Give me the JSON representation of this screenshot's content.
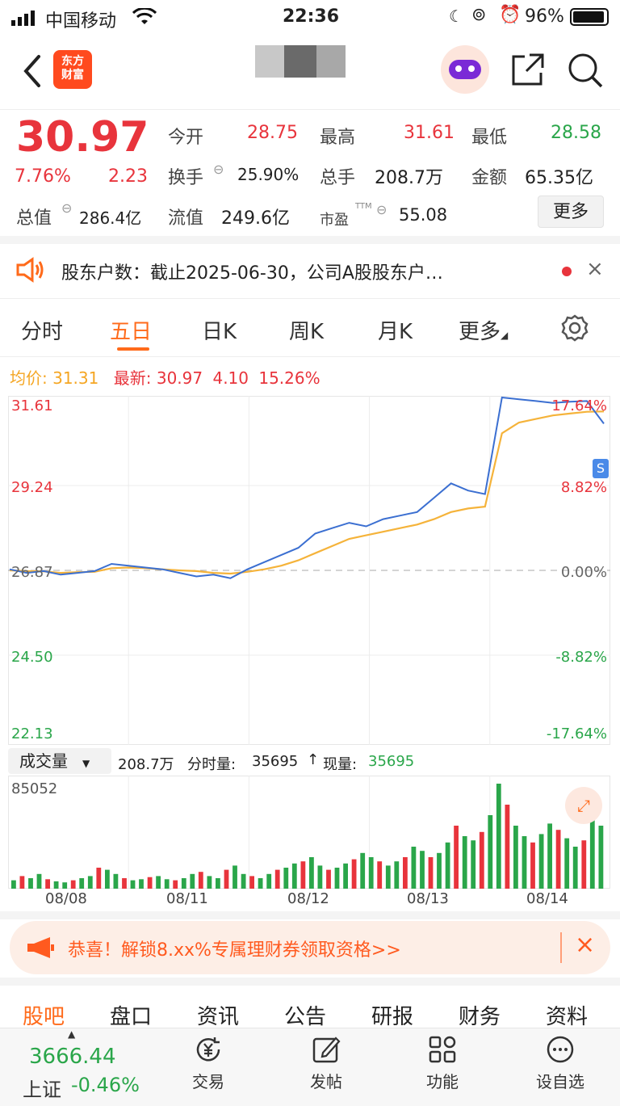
{
  "status_bar": {
    "carrier": "中国移动",
    "time": "22:36",
    "battery": "96%"
  },
  "nav": {
    "logo_text_1": "东方",
    "logo_text_2": "财富"
  },
  "quote": {
    "price": "30.97",
    "change_pct": "7.76%",
    "change": "2.23",
    "open_label": "今开",
    "open": "28.75",
    "high_label": "最高",
    "high": "31.61",
    "low_label": "最低",
    "low": "28.58",
    "turnover_label": "换手",
    "turnover": "25.90%",
    "volume_label": "总手",
    "volume": "208.7万",
    "amount_label": "金额",
    "amount": "65.35亿",
    "mktcap_label": "总值",
    "mktcap": "286.4亿",
    "float_label": "流值",
    "float": "249.6亿",
    "pe_label": "市盈",
    "pe_sup": "TTM",
    "pe": "55.08",
    "more_label": "更多"
  },
  "notice": {
    "text": "股东户数：截止2025-06-30，公司A股股东户…"
  },
  "tabs": [
    {
      "label": "分时"
    },
    {
      "label": "五日"
    },
    {
      "label": "日K"
    },
    {
      "label": "周K"
    },
    {
      "label": "月K"
    },
    {
      "label": "更多"
    }
  ],
  "legend": {
    "avg_label": "均价:",
    "avg": "31.31",
    "latest_label": "最新:",
    "latest": "30.97",
    "chg": "4.10",
    "chg_pct": "15.26%"
  },
  "chart_data": {
    "type": "line",
    "y_left_ticks": [
      "31.61",
      "29.24",
      "26.87",
      "24.50",
      "22.13"
    ],
    "y_right_ticks": [
      "17.64%",
      "8.82%",
      "0.00%",
      "-8.82%",
      "-17.64%"
    ],
    "ylim": [
      22.13,
      31.61
    ],
    "x_days": [
      "08/08",
      "08/11",
      "08/12",
      "08/13",
      "08/14"
    ],
    "series": [
      {
        "values": [
          26.9,
          26.8,
          26.85,
          26.75,
          26.8,
          26.85,
          27.05,
          27.0,
          26.95,
          26.9,
          26.8,
          26.7,
          26.75,
          26.65,
          26.9,
          27.1,
          27.3,
          27.5,
          27.9,
          28.05,
          28.2,
          28.1,
          28.3,
          28.4,
          28.5,
          28.9,
          29.3,
          29.1,
          29.0,
          31.7,
          31.65,
          31.6,
          31.55,
          31.58,
          31.6,
          30.97
        ]
      },
      {
        "values": [
          26.87,
          26.85,
          26.84,
          26.8,
          26.82,
          26.83,
          26.93,
          26.95,
          26.93,
          26.9,
          26.87,
          26.85,
          26.8,
          26.78,
          26.83,
          26.9,
          27.0,
          27.15,
          27.35,
          27.55,
          27.75,
          27.85,
          27.95,
          28.05,
          28.15,
          28.3,
          28.5,
          28.6,
          28.65,
          30.7,
          31.0,
          31.1,
          31.2,
          31.25,
          31.3,
          31.31
        ]
      }
    ]
  },
  "volume": {
    "selector": "成交量",
    "total": "208.7万",
    "tick_label": "分时量:",
    "tick_vol": "35695",
    "now_label": "现量:",
    "now_vol": "35695",
    "max": "85052",
    "bars": [
      8,
      12,
      10,
      14,
      9,
      7,
      6,
      8,
      10,
      12,
      20,
      18,
      14,
      10,
      8,
      9,
      11,
      12,
      9,
      8,
      10,
      14,
      16,
      12,
      10,
      18,
      22,
      14,
      12,
      10,
      14,
      18,
      20,
      24,
      26,
      30,
      22,
      18,
      20,
      24,
      28,
      34,
      30,
      26,
      22,
      26,
      30,
      40,
      36,
      30,
      34,
      44,
      60,
      50,
      46,
      54,
      70,
      100,
      80,
      60,
      50,
      44,
      52,
      62,
      56,
      48,
      40,
      46,
      80,
      60
    ]
  },
  "promo": {
    "text": "恭喜！解锁8.xx%专属理财券领取资格>>"
  },
  "bottom_tabs": [
    {
      "label": "股吧"
    },
    {
      "label": "盘口"
    },
    {
      "label": "资讯"
    },
    {
      "label": "公告"
    },
    {
      "label": "研报"
    },
    {
      "label": "财务"
    },
    {
      "label": "资料"
    }
  ],
  "index": {
    "value": "3666.44",
    "name": "上证",
    "change": "-0.46%"
  },
  "toolbar": [
    {
      "label": "交易"
    },
    {
      "label": "发帖"
    },
    {
      "label": "功能"
    },
    {
      "label": "设自选"
    }
  ],
  "colors": {
    "up": "#e8343c",
    "down": "#2aa64a",
    "accent": "#ff6a1a",
    "line": "#3b6fd1",
    "avg": "#f5b33a"
  }
}
